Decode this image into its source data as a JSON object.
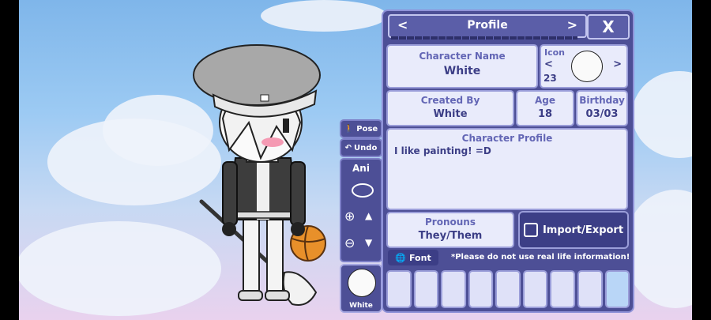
{
  "header": {
    "title": "Profile",
    "prev_label": "<",
    "next_label": ">",
    "close_label": "X"
  },
  "character_name": {
    "label": "Character Name",
    "value": "White"
  },
  "icon": {
    "label": "Icon",
    "number": "23"
  },
  "created_by": {
    "label": "Created By",
    "value": "White"
  },
  "age": {
    "label": "Age",
    "value": "18"
  },
  "birthday": {
    "label": "Birthday",
    "value": "03/03"
  },
  "profile": {
    "label": "Character Profile",
    "value": "I like painting! =D"
  },
  "pronouns": {
    "label": "Pronouns",
    "value": "They/Them"
  },
  "import_export": {
    "label": "Import/Export"
  },
  "font_button": {
    "label": "Font"
  },
  "notice": "*Please do not use real life information!",
  "tools": {
    "pose": "Pose",
    "undo": "Undo",
    "ani": "Ani"
  },
  "thumbnail": {
    "label": "White"
  },
  "categories": [
    "presets-icon",
    "body-icon",
    "hair-icon",
    "face-icon",
    "eyes-icon",
    "top-icon",
    "bottom-icon",
    "accessory-icon",
    "background-icon"
  ],
  "colors": {
    "panel": "#4d4f96",
    "box": "#e9ebfb",
    "accent": "#3c3e86"
  }
}
